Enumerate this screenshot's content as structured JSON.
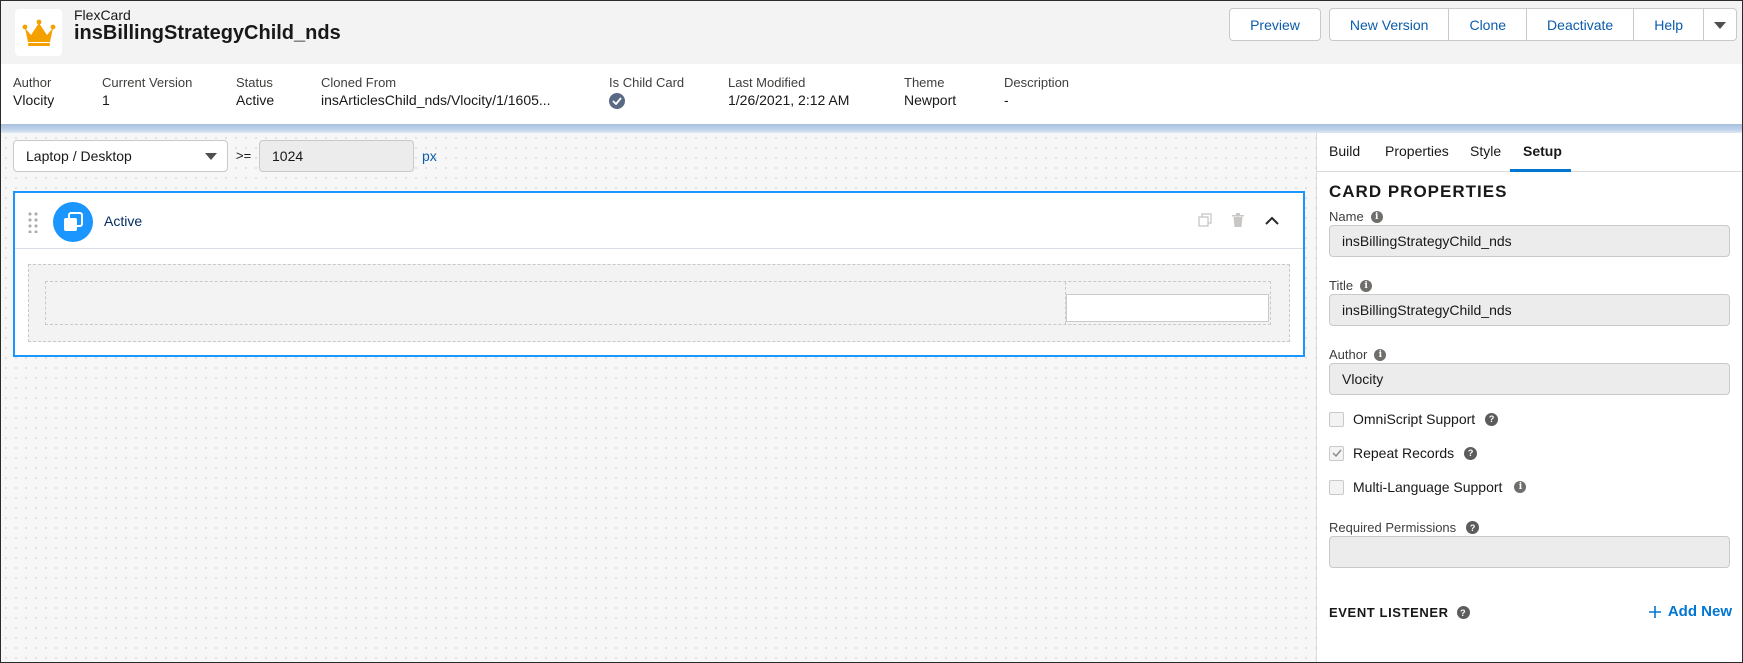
{
  "header": {
    "object_type": "FlexCard",
    "title": "insBillingStrategyChild_nds",
    "actions": {
      "preview": "Preview",
      "new_version": "New Version",
      "clone": "Clone",
      "deactivate": "Deactivate",
      "help": "Help"
    }
  },
  "highlights": [
    {
      "label": "Author",
      "value": "Vlocity"
    },
    {
      "label": "Current Version",
      "value": "1"
    },
    {
      "label": "Status",
      "value": "Active"
    },
    {
      "label": "Cloned From",
      "value": "insArticlesChild_nds/Vlocity/1/1605..."
    },
    {
      "label": "Is Child Card",
      "value": ""
    },
    {
      "label": "Last Modified",
      "value": "1/26/2021, 2:12 AM"
    },
    {
      "label": "Theme",
      "value": "Newport"
    },
    {
      "label": "Description",
      "value": "-"
    }
  ],
  "canvas": {
    "device": "Laptop / Desktop",
    "operator": ">=",
    "width_value": "1024",
    "unit": "px",
    "state": {
      "name": "Active"
    }
  },
  "panel": {
    "tabs": [
      "Build",
      "Properties",
      "Style",
      "Setup"
    ],
    "active_tab": "Setup",
    "section_title": "CARD PROPERTIES",
    "fields": {
      "name_label": "Name",
      "name_value": "insBillingStrategyChild_nds",
      "title_label": "Title",
      "title_value": "insBillingStrategyChild_nds",
      "author_label": "Author",
      "author_value": "Vlocity",
      "omniscript_label": "OmniScript Support",
      "repeat_label": "Repeat Records",
      "multilang_label": "Multi-Language Support",
      "permissions_label": "Required Permissions",
      "permissions_value": ""
    },
    "checkboxes": {
      "omniscript": false,
      "repeat": true,
      "multilang": false
    },
    "event_listener_title": "EVENT LISTENER",
    "add_new": "Add New"
  },
  "colors": {
    "brand_blue": "#0176d3",
    "link_blue": "#0b5cab",
    "selection_border": "#1b96ff",
    "app_icon": "#f4a100"
  }
}
